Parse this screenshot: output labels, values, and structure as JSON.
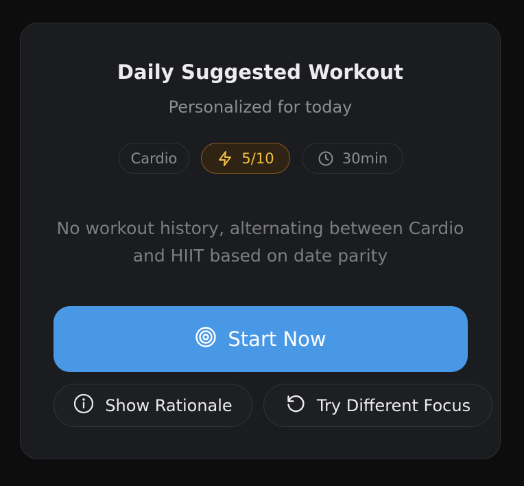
{
  "card": {
    "title": "Daily Suggested Workout",
    "subtitle": "Personalized for today",
    "chips": {
      "type": "Cardio",
      "intensity": "5/10",
      "intensity_icon": "lightning-bolt-icon",
      "duration": "30min",
      "duration_icon": "clock-icon"
    },
    "rationale": "No workout history, alternating between Cardio and HIIT based on date parity",
    "start_button": {
      "label": "Start Now",
      "icon": "target-icon"
    },
    "show_rationale_button": {
      "label": "Show Rationale",
      "icon": "info-icon"
    },
    "try_focus_button": {
      "label": "Try Different Focus",
      "icon": "refresh-icon"
    }
  },
  "colors": {
    "background": "#0d0d0e",
    "card": "#1b1c1f",
    "accent": "#4898e6",
    "intensity": "#f2c040"
  }
}
